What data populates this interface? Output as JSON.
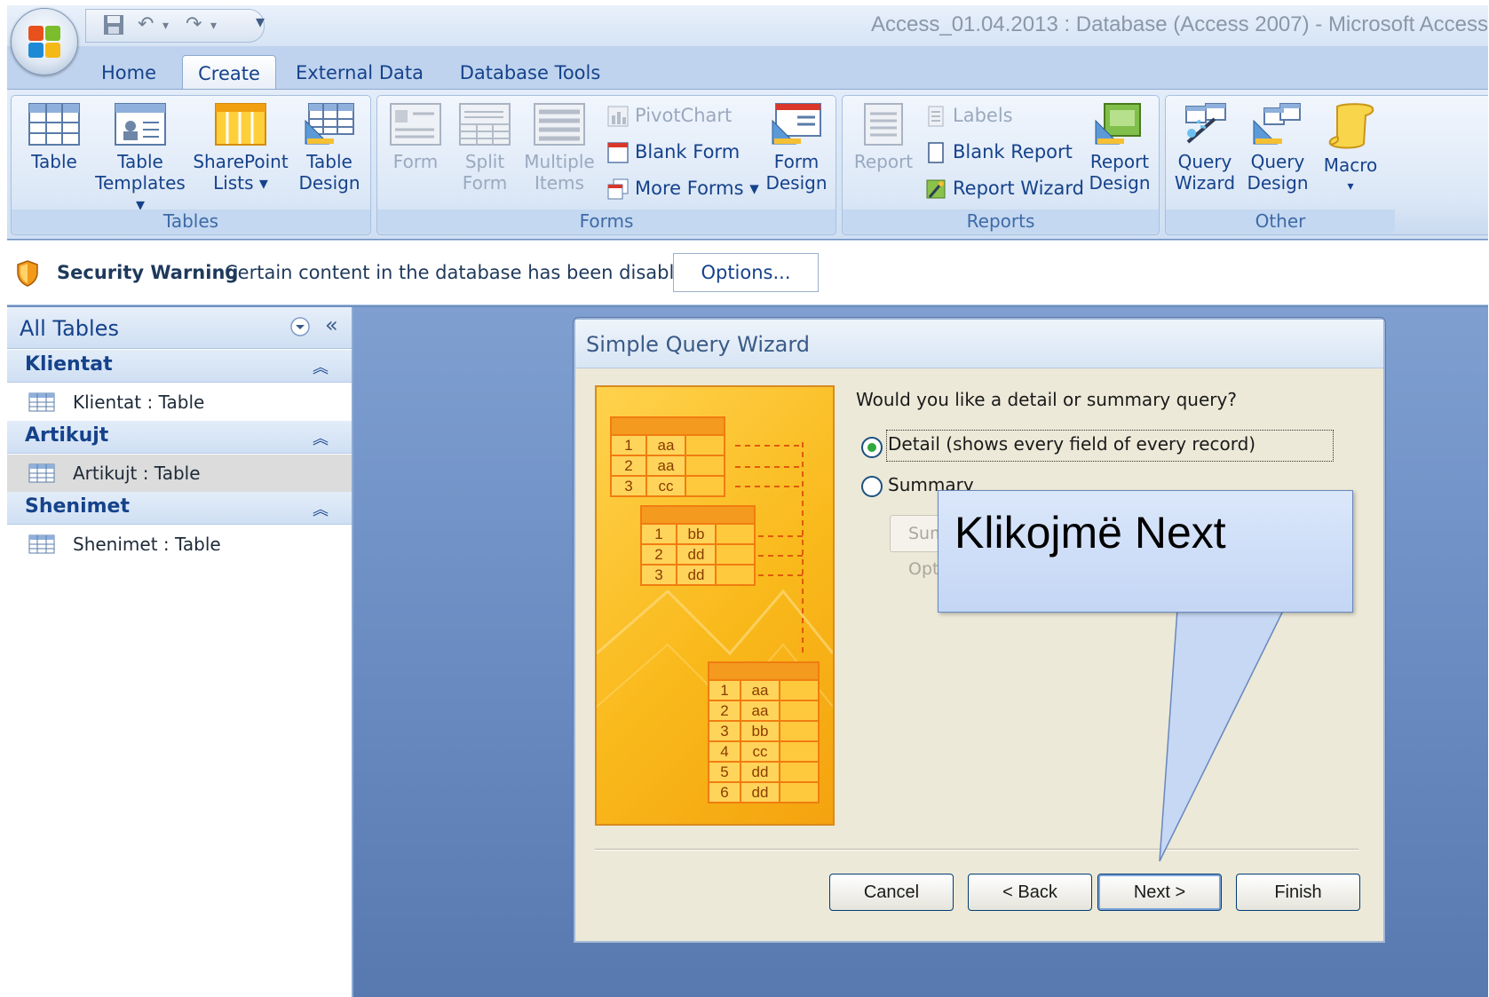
{
  "window": {
    "title": "Access_01.04.2013 : Database (Access 2007) - Microsoft Access"
  },
  "quick_access": {
    "customize_symbol": "▾"
  },
  "tabs": [
    "Home",
    "Create",
    "External Data",
    "Database Tools"
  ],
  "active_tab": "Create",
  "ribbon": {
    "tables": {
      "label": "Tables",
      "table": "Table",
      "table_templates": [
        "Table",
        "Templates ▾"
      ],
      "sharepoint_lists": [
        "SharePoint",
        "Lists ▾"
      ],
      "table_design": [
        "Table",
        "Design"
      ]
    },
    "forms": {
      "label": "Forms",
      "form": "Form",
      "split_form": [
        "Split",
        "Form"
      ],
      "multiple_items": [
        "Multiple",
        "Items"
      ],
      "pivotchart": "PivotChart",
      "blank_form": "Blank Form",
      "more_forms": "More Forms ▾",
      "form_design": [
        "Form",
        "Design"
      ]
    },
    "reports": {
      "label": "Reports",
      "report": "Report",
      "labels": "Labels",
      "blank_report": "Blank Report",
      "report_wizard": "Report Wizard",
      "report_design": [
        "Report",
        "Design"
      ]
    },
    "other": {
      "label": "Other",
      "query_wizard": [
        "Query",
        "Wizard"
      ],
      "query_design": [
        "Query",
        "Design"
      ],
      "macro": [
        "Macro",
        "▾"
      ]
    }
  },
  "message_bar": {
    "title": "Security Warning",
    "text": "Certain content in the database has been disabled",
    "options_button": "Options..."
  },
  "nav_pane": {
    "title": "All Tables",
    "collapse_symbol": "«",
    "groups": [
      {
        "name": "Klientat",
        "item": "Klientat : Table"
      },
      {
        "name": "Artikujt",
        "item": "Artikujt : Table"
      },
      {
        "name": "Shenimet",
        "item": "Shenimet : Table"
      }
    ]
  },
  "dialog": {
    "title": "Simple Query Wizard",
    "question": "Would you like a detail or summary query?",
    "option_detail": "Detail (shows every field of every record)",
    "option_summary": "Summary",
    "selected_option": "detail",
    "summary_options_button": "Summary Options...",
    "buttons": {
      "cancel": "Cancel",
      "back": "< Back",
      "next": "Next >",
      "finish": "Finish"
    },
    "illustration": {
      "table1": [
        [
          "1",
          "aa"
        ],
        [
          "2",
          "aa"
        ],
        [
          "3",
          "cc"
        ]
      ],
      "table2": [
        [
          "1",
          "bb"
        ],
        [
          "2",
          "dd"
        ],
        [
          "3",
          "dd"
        ]
      ],
      "table3": [
        [
          "1",
          "aa"
        ],
        [
          "2",
          "aa"
        ],
        [
          "3",
          "bb"
        ],
        [
          "4",
          "cc"
        ],
        [
          "5",
          "dd"
        ],
        [
          "6",
          "dd"
        ]
      ]
    }
  },
  "callout": {
    "text": "Klikojmë Next"
  },
  "colors": {
    "ribbon_text": "#15428b",
    "accent": "#f9b91b",
    "workspace": "#6a8cc2"
  }
}
